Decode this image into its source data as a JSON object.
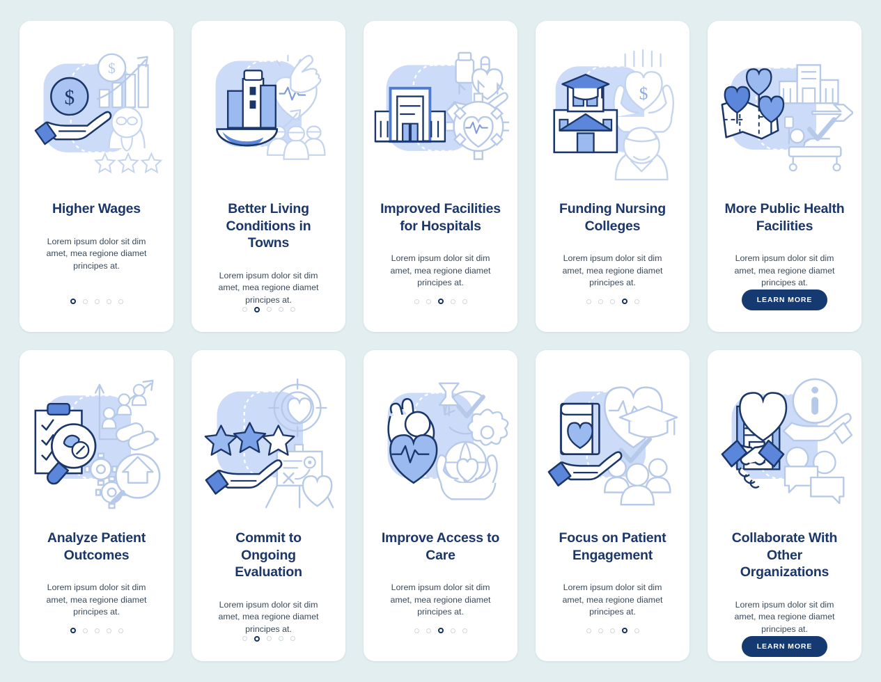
{
  "palette": {
    "page_background": "#e2eef0",
    "card_background": "#ffffff",
    "title_color": "#1b3668",
    "body_text_color": "#3b4a5a",
    "accent_navy": "#153a72",
    "accent_blue": "#5b86da",
    "light_blue_fill": "#c9d9f7",
    "line_blue": "#b6c9e8",
    "dot_inactive": "#cfd8dd",
    "dot_active": "#12305e"
  },
  "common": {
    "description": "Lorem ipsum dolor sit dim amet, mea regione diamet principes at.",
    "learn_more_label": "LEARN MORE",
    "dot_count": 5
  },
  "rows": [
    {
      "screens": [
        {
          "title": "Higher Wages",
          "description": "Lorem ipsum dolor sit dim amet, mea regione diamet principes at.",
          "active_dot": 0,
          "has_learn_more": false,
          "illustration": "hand-holding-dollar-coin-bar-chart-doctor-stars"
        },
        {
          "title": "Better Living Conditions in Towns",
          "description": "Lorem ipsum dolor sit dim amet, mea regione diamet principes at.",
          "active_dot": 1,
          "has_learn_more": false,
          "illustration": "city-buildings-globe-heart-pulse-hand-people-arrow"
        },
        {
          "title": "Improved Facilities for Hospitals",
          "description": "Lorem ipsum dolor sit dim amet, mea regione diamet principes at.",
          "active_dot": 2,
          "has_learn_more": false,
          "illustration": "hospital-building-medicine-bottle-hand-gear-heart-pulse"
        },
        {
          "title": "Funding Nursing Colleges",
          "description": "Lorem ipsum dolor sit dim amet, mea regione diamet principes at.",
          "active_dot": 3,
          "has_learn_more": false,
          "illustration": "college-building-graduation-cap-hands-heart-dollar-nurse"
        },
        {
          "title": "More Public Health Facilities",
          "description": "Lorem ipsum dolor sit dim amet, mea regione diamet principes at.",
          "active_dot": 4,
          "has_learn_more": true,
          "illustration": "map-heart-pins-clinic-buildings-arrow-hospital-bed-check"
        }
      ]
    },
    {
      "screens": [
        {
          "title": "Analyze Patient Outcomes",
          "description": "Lorem ipsum dolor sit dim amet, mea regione diamet principes at.",
          "active_dot": 0,
          "has_learn_more": false,
          "illustration": "clipboard-checklist-magnifier-pills-chart-people-gears-arrow"
        },
        {
          "title": "Commit to Ongoing Evaluation",
          "description": "Lorem ipsum dolor sit dim amet, mea regione diamet principes at.",
          "active_dot": 1,
          "has_learn_more": false,
          "illustration": "hand-three-stars-target-heart-presentation-board"
        },
        {
          "title": "Improve Access to Care",
          "description": "Lorem ipsum dolor sit dim amet, mea regione diamet principes at.",
          "active_dot": 2,
          "has_learn_more": false,
          "illustration": "ok-hand-heart-pulse-check-gear-cycle-hands-globe"
        },
        {
          "title": "Focus on Patient Engagement",
          "description": "Lorem ipsum dolor sit dim amet, mea regione diamet principes at.",
          "active_dot": 3,
          "has_learn_more": false,
          "illustration": "hand-book-heart-pulse-graduation-cap-check-people-group"
        },
        {
          "title": "Collaborate With Other Organizations",
          "description": "Lorem ipsum dolor sit dim amet, mea regione diamet principes at.",
          "active_dot": 4,
          "has_learn_more": true,
          "illustration": "handshake-heart-document-info-person-hand-chat-bubbles"
        }
      ]
    }
  ]
}
